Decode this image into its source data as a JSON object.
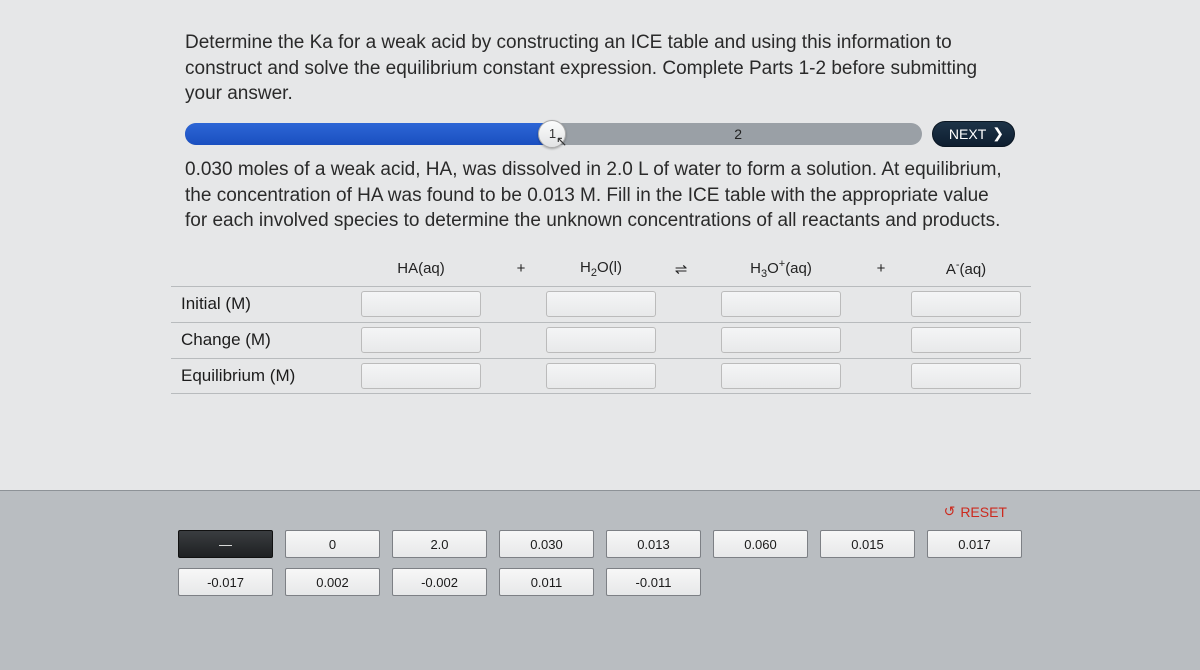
{
  "prompt": "Determine the Ka for a weak acid by constructing an ICE table and using this information to construct and solve the equilibrium constant expression. Complete Parts 1-2 before submitting your answer.",
  "steps": {
    "current": "1",
    "next": "2"
  },
  "next_btn": "NEXT",
  "subprompt": "0.030 moles of a weak acid, HA, was dissolved in 2.0 L of water to form a solution. At equilibrium, the concentration of HA was found to be 0.013 M.  Fill in the ICE table with the appropriate value for each involved species to determine the unknown concentrations of all reactants and products.",
  "equation": {
    "sp1": "HA(aq)",
    "op1": "+",
    "sp2_pre": "H",
    "sp2_sub": "2",
    "sp2_post": "O(l)",
    "op2": "⇌",
    "sp3_pre": "H",
    "sp3_sub": "3",
    "sp3_post": "O",
    "sp3_sup": "+",
    "sp3_tail": "(aq)",
    "op3": "+",
    "sp4_pre": "A",
    "sp4_sup": "-",
    "sp4_tail": "(aq)"
  },
  "rows": {
    "r1": "Initial (M)",
    "r2": "Change (M)",
    "r3": "Equilibrium (M)"
  },
  "reset": "RESET",
  "tiles": {
    "t0": "—",
    "t1": "0",
    "t2": "2.0",
    "t3": "0.030",
    "t4": "0.013",
    "t5": "0.060",
    "t6": "0.015",
    "t7": "0.017",
    "t8": "-0.017",
    "t9": "0.002",
    "t10": "-0.002",
    "t11": "0.011",
    "t12": "-0.011"
  }
}
